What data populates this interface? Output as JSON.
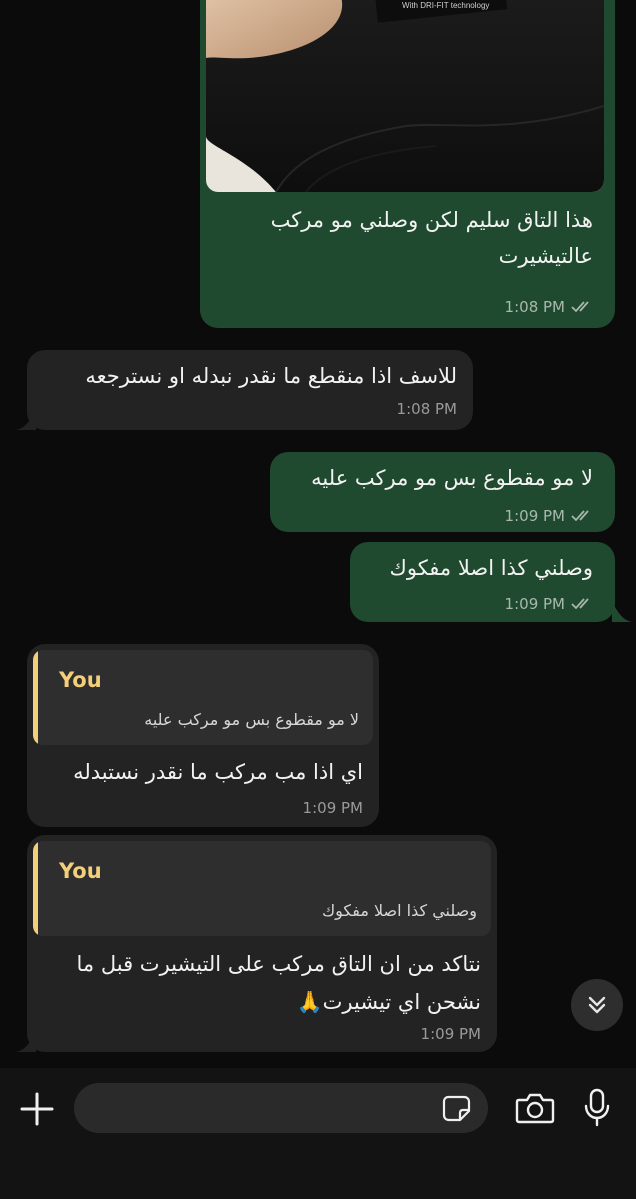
{
  "messages": [
    {
      "id": "m1",
      "direction": "outgoing",
      "type": "image",
      "lines": [
        "هذا التاق سليم لكن وصلني مو مركب",
        "عالتيشيرت"
      ],
      "time": "1:08 PM",
      "status": "read",
      "image_text": "With DRI-FIT technology"
    },
    {
      "id": "m2",
      "direction": "incoming",
      "lines": [
        "للاسف اذا منقطع ما نقدر نبدله او نسترجعه"
      ],
      "time": "1:08 PM"
    },
    {
      "id": "m3",
      "direction": "outgoing",
      "lines": [
        "لا مو مقطوع بس مو مركب عليه"
      ],
      "time": "1:09 PM",
      "status": "read"
    },
    {
      "id": "m4",
      "direction": "outgoing",
      "lines": [
        "وصلني كذا اصلا مفكوك"
      ],
      "time": "1:09 PM",
      "status": "read"
    },
    {
      "id": "m5",
      "direction": "incoming",
      "reply": {
        "author": "You",
        "text": "لا مو مقطوع بس مو مركب عليه"
      },
      "lines": [
        "اي اذا مب مركب ما نقدر نستبدله"
      ],
      "time": "1:09 PM"
    },
    {
      "id": "m6",
      "direction": "incoming",
      "reply": {
        "author": "You",
        "text": "وصلني كذا اصلا مفكوك"
      },
      "lines": [
        "نتاكد من ان التاق مركب على التيشيرت قبل ما",
        "نشحن اي تيشيرت🙏"
      ],
      "time": "1:09 PM"
    }
  ],
  "composer": {
    "placeholder": "",
    "icons": [
      "plus-icon",
      "sticker-icon",
      "camera-icon",
      "microphone-icon"
    ]
  },
  "scroll_button_icon": "double-chevron-down-icon",
  "colors": {
    "outgoing_bubble": "#1f4a2f",
    "incoming_bubble": "#232323",
    "reply_accent": "#f3cf7a",
    "background": "#0b0b0b"
  }
}
